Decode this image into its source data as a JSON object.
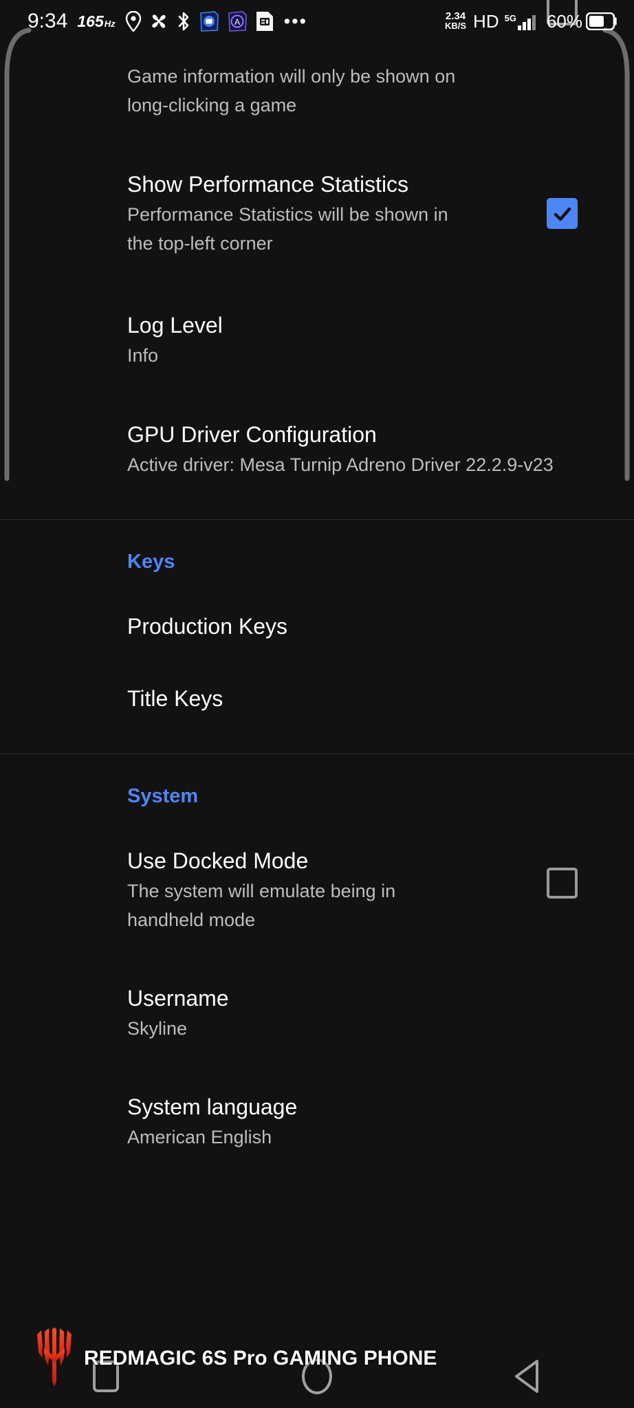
{
  "status_bar": {
    "clock": "9:34",
    "refresh_rate": "165",
    "refresh_unit": "Hz",
    "icons": [
      "location-pin-icon",
      "fan-icon",
      "bluetooth-icon",
      "app-notification-icon",
      "app-notification-icon-2",
      "sim-notification-icon"
    ],
    "overflow": "•••",
    "data_rate": "2.34",
    "data_rate_unit": "KB/S",
    "voice_quality": "HD",
    "network_type": "5G",
    "battery_percent": "60%"
  },
  "settings": {
    "items": [
      {
        "name": "show-game-information",
        "summary": "Game information will only be shown on long-clicking a game",
        "widget": "checkbox",
        "checked": false
      },
      {
        "name": "show-performance-statistics",
        "title": "Show Performance Statistics",
        "summary": "Performance Statistics will be shown in the top-left corner",
        "widget": "checkbox",
        "checked": true
      },
      {
        "name": "log-level",
        "title": "Log Level",
        "summary": "Info",
        "widget": "none"
      },
      {
        "name": "gpu-driver-configuration",
        "title": "GPU Driver Configuration",
        "summary": "Active driver: Mesa Turnip Adreno Driver 22.2.9-v23",
        "widget": "none"
      }
    ],
    "keys_section": {
      "header": "Keys",
      "items": [
        {
          "name": "production-keys",
          "title": "Production Keys"
        },
        {
          "name": "title-keys",
          "title": "Title Keys"
        }
      ]
    },
    "system_section": {
      "header": "System",
      "items": [
        {
          "name": "use-docked-mode",
          "title": "Use Docked Mode",
          "summary": "The system will emulate being in handheld mode",
          "widget": "checkbox",
          "checked": false
        },
        {
          "name": "username",
          "title": "Username",
          "summary": "Skyline",
          "widget": "none"
        },
        {
          "name": "system-language",
          "title": "System language",
          "summary": "American English",
          "widget": "none"
        }
      ]
    }
  },
  "watermark": {
    "text": "REDMAGIC 6S Pro GAMING PHONE",
    "logo": "redmagic-logo-icon"
  },
  "navbar": {
    "recents": "recents-square-icon",
    "home": "home-circle-icon",
    "back": "back-triangle-icon"
  },
  "colors": {
    "accent": "#4d86f7",
    "background": "#121212",
    "primary_text": "#ffffff",
    "secondary_text": "#bdbdbd",
    "divider": "#2a2a2a",
    "logo_red": "#e8331c"
  }
}
